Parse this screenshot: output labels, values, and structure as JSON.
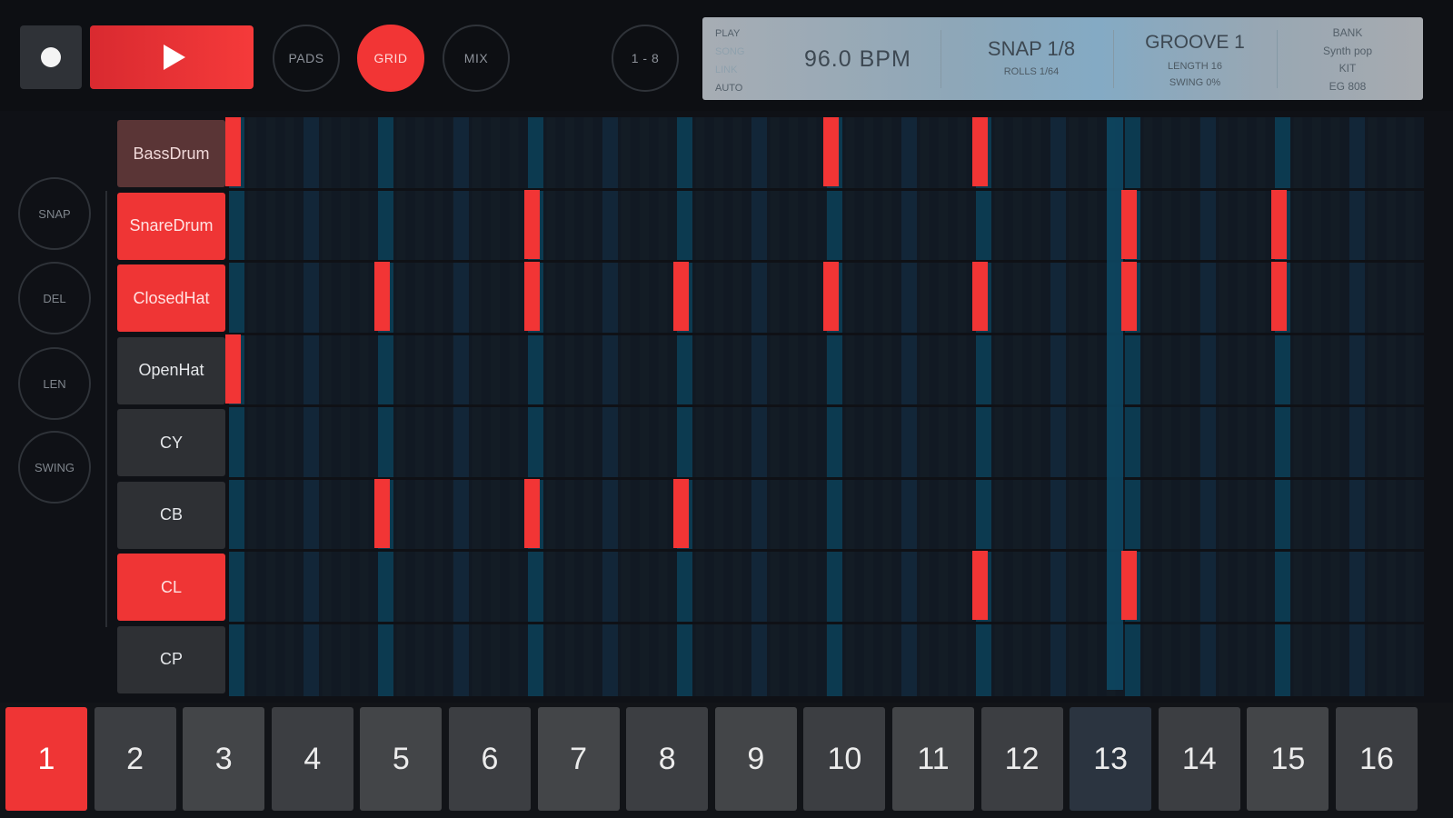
{
  "transport": {
    "record_label": "",
    "play_label": ""
  },
  "modes": {
    "pads": "PADS",
    "grid": "GRID",
    "mix": "MIX",
    "active": "GRID",
    "range": "1 - 8"
  },
  "display": {
    "flags": [
      "PLAY",
      "SONG",
      "LINK",
      "AUTO"
    ],
    "bpm": "96.0 BPM",
    "snap": "SNAP 1/8",
    "rolls": "ROLLS 1/64",
    "groove": "GROOVE 1",
    "length": "LENGTH 16",
    "swing": "SWING 0%",
    "bank_label": "BANK",
    "bank_value": "Synth pop",
    "kit_label": "KIT",
    "kit_value": "EG 808"
  },
  "tools": [
    "SNAP",
    "DEL",
    "LEN",
    "SWING"
  ],
  "instruments": [
    {
      "name": "BassDrum",
      "state": "dim"
    },
    {
      "name": "SnareDrum",
      "state": "on"
    },
    {
      "name": "ClosedHat",
      "state": "on"
    },
    {
      "name": "OpenHat",
      "state": "off"
    },
    {
      "name": "CY",
      "state": "off"
    },
    {
      "name": "CB",
      "state": "off"
    },
    {
      "name": "CL",
      "state": "on"
    },
    {
      "name": "CP",
      "state": "off"
    }
  ],
  "grid": {
    "steps": 16,
    "playhead_step": 13,
    "pattern": {
      "BassDrum": [
        1,
        9,
        11
      ],
      "SnareDrum": [
        5,
        13,
        15
      ],
      "ClosedHat": [
        3,
        5,
        7,
        9,
        11,
        13,
        15
      ],
      "OpenHat": [
        1
      ],
      "CY": [],
      "CB": [
        3,
        5,
        7
      ],
      "CL": [
        11,
        13
      ],
      "CP": []
    }
  },
  "steps": {
    "labels": [
      "1",
      "2",
      "3",
      "4",
      "5",
      "6",
      "7",
      "8",
      "9",
      "10",
      "11",
      "12",
      "13",
      "14",
      "15",
      "16"
    ],
    "selected": 1,
    "current": 13
  },
  "colors": {
    "accent": "#f23535",
    "playhead": "#0d4a66",
    "grid_bg": "#121a22"
  }
}
